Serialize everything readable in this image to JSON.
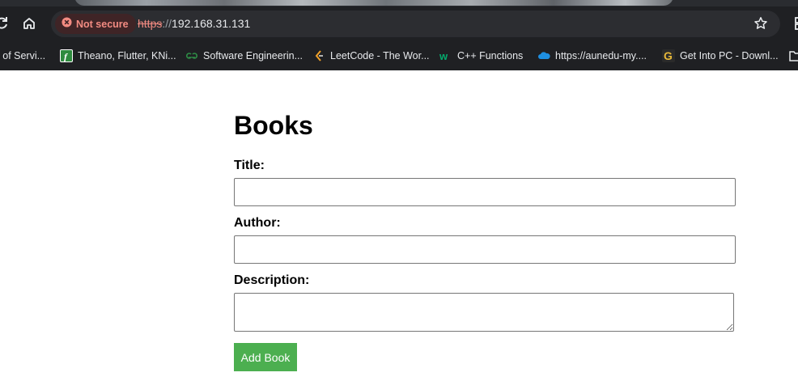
{
  "browser": {
    "security_label": "Not secure",
    "url_scheme": "https",
    "url_separator": "://",
    "url_host": "192.168.31.131"
  },
  "bookmarks": [
    {
      "label": "l of Servi...",
      "icon": "none"
    },
    {
      "label": "Theano, Flutter, KNi...",
      "icon": "green-f-icon"
    },
    {
      "label": "Software Engineerin...",
      "icon": "geeksforgeeks-icon"
    },
    {
      "label": "LeetCode - The Wor...",
      "icon": "leetcode-icon"
    },
    {
      "label": "C++ Functions",
      "icon": "w3schools-icon"
    },
    {
      "label": "https://aunedu-my....",
      "icon": "onedrive-cloud-icon"
    },
    {
      "label": "Get Into PC - Downl...",
      "icon": "getintopc-icon"
    }
  ],
  "page": {
    "heading": "Books",
    "title_label": "Title:",
    "author_label": "Author:",
    "description_label": "Description:",
    "title_value": "",
    "author_value": "",
    "description_value": "",
    "submit_label": "Add Book"
  },
  "colors": {
    "submit_button": "#4caf50",
    "browser_chrome": "#1f2023",
    "not_secure": "#f28b82"
  }
}
